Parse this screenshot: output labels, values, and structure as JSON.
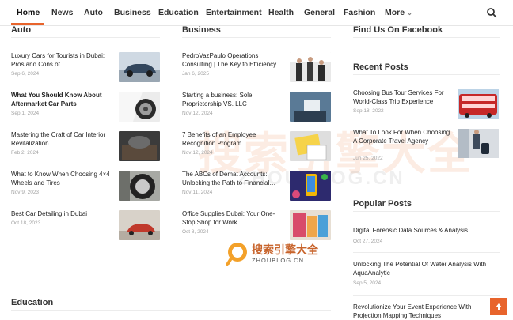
{
  "nav": {
    "items": [
      "Home",
      "News",
      "Auto",
      "Business",
      "Education",
      "Entertainment",
      "Health",
      "General",
      "Fashion",
      "More"
    ],
    "search_icon": "search-icon",
    "accent": "#e8642c"
  },
  "auto": {
    "title": "Auto",
    "posts": [
      {
        "title": "Luxury Cars for Tourists in Dubai: Pros and Cons of…",
        "date": "Sep 6, 2024"
      },
      {
        "title": "What You Should Know About Aftermarket Car Parts",
        "date": "Sep 1, 2024"
      },
      {
        "title": "Mastering the Craft of Car Interior Revitalization",
        "date": "Feb 2, 2024"
      },
      {
        "title": "What to Know When Choosing 4×4 Wheels and Tires",
        "date": "Nov 9, 2023"
      },
      {
        "title": "Best Car Detailing in Dubai",
        "date": "Oct 18, 2023"
      }
    ]
  },
  "business": {
    "title": "Business",
    "posts": [
      {
        "title": "PedroVazPaulo Operations Consulting | The Key to Efficiency",
        "date": "Jan 6, 2025"
      },
      {
        "title": "Starting a business: Sole Proprietorship VS. LLC",
        "date": "Nov 12, 2024"
      },
      {
        "title": "7 Benefits of an Employee Recognition Program",
        "date": "Nov 12, 2024"
      },
      {
        "title": "The ABCs of Demat Accounts: Unlocking the Path to Financial…",
        "date": "Nov 11, 2024"
      },
      {
        "title": "Office Supplies Dubai: Your One-Stop Shop for Work",
        "date": "Oct 8, 2024"
      }
    ]
  },
  "sidebar": {
    "facebook_title": "Find Us On Facebook",
    "recent_title": "Recent Posts",
    "recent": [
      {
        "title": "Choosing Bus Tour Services For World-Class Trip Experience",
        "date": "Sep 18, 2022"
      },
      {
        "title": "What To Look For When Choosing A Corporate Travel Agency",
        "date": "Jun 25, 2022"
      }
    ],
    "popular_title": "Popular Posts",
    "popular": [
      {
        "title": "Digital Forensic Data Sources & Analysis",
        "date": "Oct 27, 2024"
      },
      {
        "title": "Unlocking The Potential Of Water Analysis With AquaAnalytic",
        "date": "Sep 5, 2024"
      },
      {
        "title": "Revolutionize Your Event Experience With Projection Mapping Techniques",
        "date": ""
      }
    ]
  },
  "education": {
    "title": "Education"
  },
  "watermark": {
    "big": "搜索引擎大全",
    "big_sub": "ZHOUBLOG.CN",
    "small": "搜索引擎大全",
    "small_sub": "ZHOUBLOG.CN"
  },
  "scroll_top_icon": "arrow-up-icon"
}
